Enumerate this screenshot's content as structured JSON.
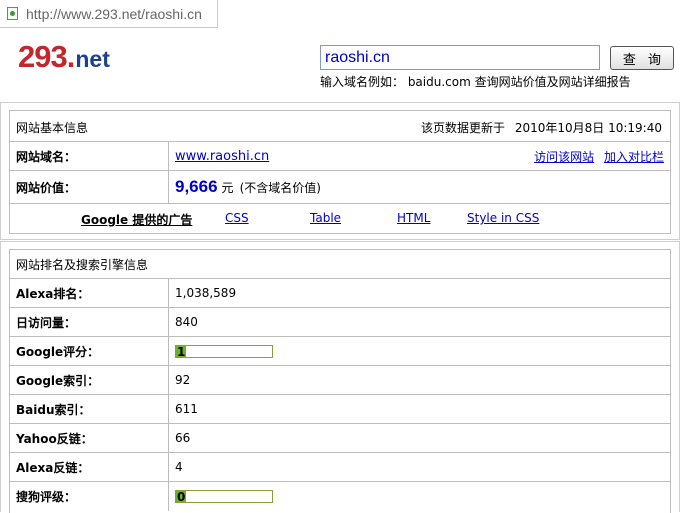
{
  "address_bar": {
    "url": "http://www.293.net/raoshi.cn"
  },
  "logo": {
    "number": "293",
    "dot": ".",
    "suffix": "net"
  },
  "search": {
    "value": "raoshi.cn",
    "button_label": "查 询",
    "hint": "输入域名例如： baidu.com 查询网站价值及网站详细报告"
  },
  "basic_info": {
    "header": "网站基本信息",
    "updated_label": "该页数据更新于",
    "updated_time": "2010年10月8日 10:19:40",
    "domain_label": "网站域名：",
    "domain_value": "www.raoshi.cn",
    "visit_link": "访问该网站",
    "compare_link": "加入对比栏",
    "value_label": "网站价值：",
    "value_number": "9,666",
    "value_unit": "元",
    "value_note": "(不含域名价值)"
  },
  "ads": {
    "google_label": "Google 提供的广告",
    "links": [
      "CSS",
      "Table",
      "HTML",
      "Style in CSS"
    ]
  },
  "ranking": {
    "header": "网站排名及搜索引擎信息",
    "rows": [
      {
        "label": "Alexa排名：",
        "value": "1,038,589"
      },
      {
        "label": "日访问量：",
        "value": "840"
      },
      {
        "label": "Google评分：",
        "value": "1",
        "bar_fraction": 0.1
      },
      {
        "label": "Google索引：",
        "value": "92"
      },
      {
        "label": "Baidu索引：",
        "value": "611"
      },
      {
        "label": "Yahoo反链：",
        "value": "66"
      },
      {
        "label": "Alexa反链：",
        "value": "4"
      },
      {
        "label": "搜狗评级：",
        "value": "0",
        "bar_fraction": 0.0
      }
    ]
  }
}
